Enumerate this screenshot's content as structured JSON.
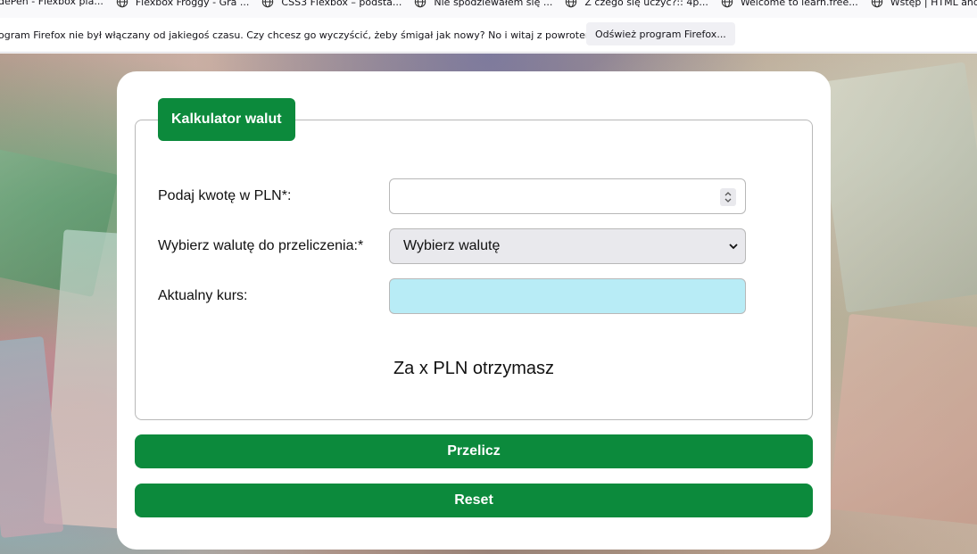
{
  "bookmarks": [
    {
      "label": "dePen - Flexbox pla..."
    },
    {
      "label": "Flexbox Froggy - Gra ..."
    },
    {
      "label": "CSS3 Flexbox – podsta..."
    },
    {
      "label": "Nie spodziewałem się ..."
    },
    {
      "label": "Z czego się uczyć?:: 4p..."
    },
    {
      "label": "Welcome to learn.free..."
    },
    {
      "label": "Wstęp | HTML and CS..."
    }
  ],
  "notification": {
    "message": "ogram Firefox nie był włączany od jakiegoś czasu. Czy chcesz go wyczyścić, żeby śmigał jak nowy? No i witaj z powrotem!",
    "button_label": "Odśwież program Firefox..."
  },
  "form": {
    "legend": "Kalkulator walut",
    "amount_label": "Podaj kwotę w PLN*:",
    "amount_value": "",
    "currency_label": "Wybierz walutę do przeliczenia:*",
    "currency_selected": "Wybierz walutę",
    "rate_label": "Aktualny kurs:",
    "rate_value": "",
    "result_text": "Za x PLN otrzymasz",
    "convert_button": "Przelicz",
    "reset_button": "Reset"
  },
  "colors": {
    "accent": "#0c8a3c",
    "rate_field_bg": "#b8ecf6",
    "select_bg": "#e9e9ed"
  }
}
